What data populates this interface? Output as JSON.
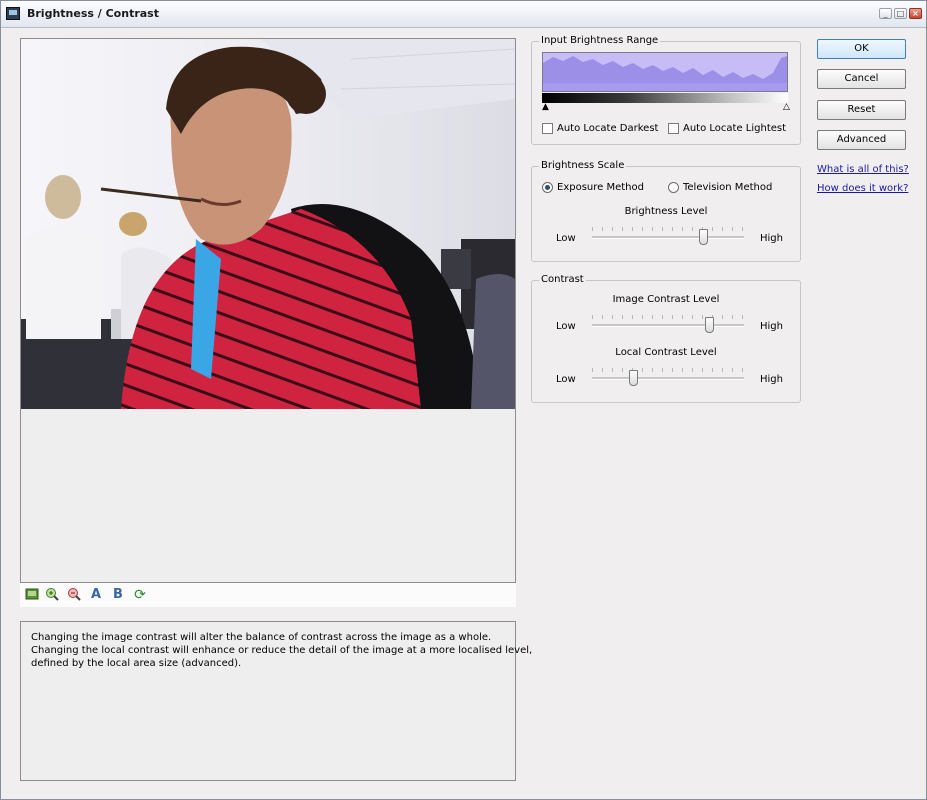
{
  "window": {
    "title": "Brightness / Contrast"
  },
  "toolbar": {
    "icons": [
      "image-icon",
      "zoom-in-icon",
      "zoom-out-icon",
      "compare-a-icon",
      "compare-b-icon",
      "refresh-icon"
    ],
    "a_label": "A",
    "b_label": "B"
  },
  "description": {
    "lines": [
      "Changing the image contrast will alter the balance of contrast across the image as a whole.",
      "Changing the local contrast will enhance or reduce the detail of the image at a more localised level,",
      "defined by the local area size (advanced)."
    ]
  },
  "input_range": {
    "title": "Input Brightness Range",
    "auto_darkest_label": "Auto Locate Darkest",
    "auto_lightest_label": "Auto Locate Lightest",
    "auto_darkest_checked": false,
    "auto_lightest_checked": false
  },
  "brightness_scale": {
    "title": "Brightness Scale",
    "exposure_label": "Exposure Method",
    "television_label": "Television Method",
    "selected": "Exposure Method",
    "level_label": "Brightness Level",
    "low": "Low",
    "high": "High",
    "level": 0.73
  },
  "contrast": {
    "title": "Contrast",
    "image_label": "Image Contrast Level",
    "local_label": "Local Contrast Level",
    "low": "Low",
    "high": "High",
    "image_level": 0.77,
    "local_level": 0.27
  },
  "buttons": {
    "ok": "OK",
    "cancel": "Cancel",
    "reset": "Reset",
    "advanced": "Advanced"
  },
  "links": {
    "what": "What is all of this?",
    "how": "How does it work?"
  }
}
